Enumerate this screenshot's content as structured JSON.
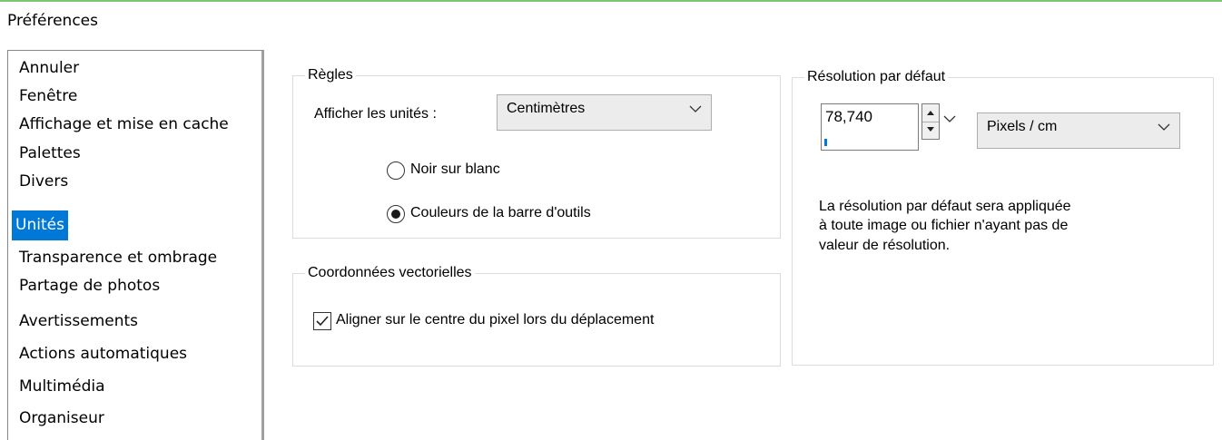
{
  "window": {
    "title": "Préférences"
  },
  "categories": [
    {
      "label": "Annuler",
      "selected": false
    },
    {
      "label": "Fenêtre",
      "selected": false
    },
    {
      "label": "Affichage et mise en cache",
      "selected": false
    },
    {
      "label": "Palettes",
      "selected": false
    },
    {
      "label": "Divers",
      "selected": false
    },
    {
      "label": "Unités",
      "selected": true
    },
    {
      "label": "Transparence et ombrage",
      "selected": false
    },
    {
      "label": "Partage de photos",
      "selected": false
    },
    {
      "label": "Avertissements",
      "selected": false
    },
    {
      "label": "Actions automatiques",
      "selected": false
    },
    {
      "label": "Multimédia",
      "selected": false
    },
    {
      "label": "Organiseur",
      "selected": false
    }
  ],
  "regles": {
    "legend": "Règles",
    "units_label": "Afficher les unités :",
    "units_value": "Centimètres",
    "radio_black_label": "Noir sur blanc",
    "radio_black_checked": false,
    "radio_toolbar_label": "Couleurs de la barre d'outils",
    "radio_toolbar_checked": true
  },
  "coords": {
    "legend": "Coordonnées vectorielles",
    "align_label": "Aligner sur le centre du pixel lors du déplacement",
    "align_checked": true
  },
  "resolution": {
    "legend": "Résolution par défaut",
    "value": "78,740",
    "unit_value": "Pixels / cm",
    "description_line1": "La résolution par défaut sera appliquée",
    "description_line2": "à toute image ou fichier n'ayant pas de",
    "description_line3": "valeur de résolution."
  },
  "colors": {
    "selection": "#0078d7",
    "top_accent": "#7dc476"
  }
}
